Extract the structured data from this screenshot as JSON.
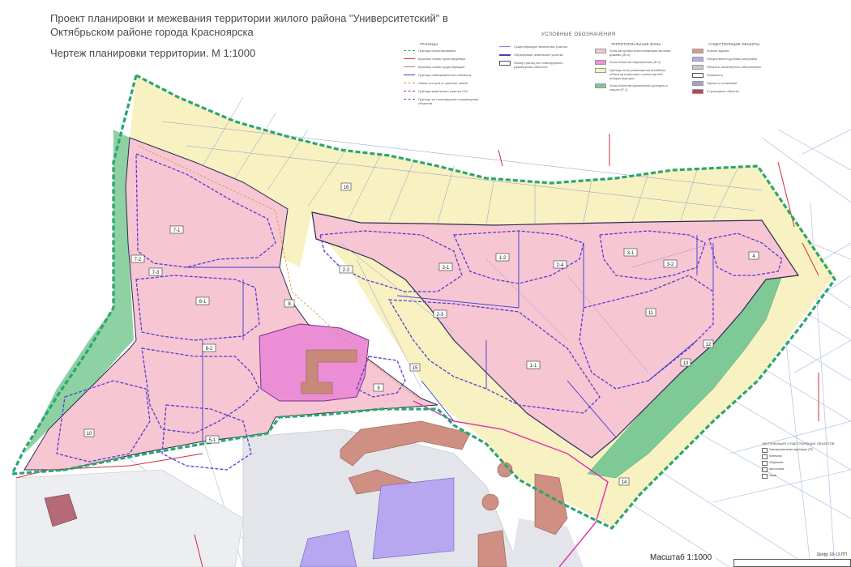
{
  "header": {
    "title": "Проект планировки и межевания территории жилого района \"Университетский\" в Октябрьском районе города Красноярска",
    "subtitle": "Чертеж планировки территории. М 1:1000"
  },
  "legend": {
    "heading": "УСЛОВНЫЕ ОБОЗНАЧЕНИЯ",
    "groups": [
      {
        "header": "ГРАНИЦЫ",
        "items": [
          {
            "label": "Граница проектирования",
            "color": "#2aa66e",
            "style": "dash-green"
          },
          {
            "label": "Красные линии проектируемые",
            "color": "#d23c3c",
            "style": "line-red"
          },
          {
            "label": "Красные линии существующие",
            "color": "#e07070",
            "style": "line-red-thin"
          },
          {
            "label": "Граница планировочного элемента",
            "color": "#3a3ad0",
            "style": "line-blue"
          },
          {
            "label": "Линии отступа от красных линий",
            "color": "#e09040",
            "style": "dash-orange"
          },
          {
            "label": "Граница земельного участка СЗУ",
            "color": "#8a3ad0",
            "style": "dash-purple"
          },
          {
            "label": "Граница зон планируемого размещения объектов",
            "color": "#5a5ae0",
            "style": "dash-blue"
          }
        ]
      },
      {
        "header": "",
        "items": [
          {
            "label": "Существующие земельные участки",
            "color": "#8080ff",
            "style": "line-thin"
          },
          {
            "label": "Образуемые земельные участки",
            "color": "#4040c0",
            "style": "line-thick"
          },
          {
            "label": "Номер границ зон планируемого размещения объектов",
            "color": "#ffffff",
            "style": "box"
          }
        ]
      },
      {
        "header": "ТЕРРИТОРИАЛЬНЫЕ ЗОНЫ",
        "items": [
          {
            "label": "Зона застройки многоэтажными жилыми домами (Ж-4)",
            "color": "#f5c4d2",
            "style": "fill"
          },
          {
            "label": "Зона объектов образования (Ж-2)",
            "color": "#ee90d8",
            "style": "fill"
          },
          {
            "label": "Граница зоны размещения линейных объектов инженерно-транспортной инфраструктуры",
            "color": "#f8f1c0",
            "style": "fill"
          },
          {
            "label": "Зона объектов физической культуры и спорта (Р-1)",
            "color": "#7ec995",
            "style": "fill"
          }
        ]
      },
      {
        "header": "СУЩЕСТВУЮЩИЕ ОБЪЕКТЫ",
        "items": [
          {
            "label": "Жилые здания",
            "color": "#d89a8a",
            "style": "fill"
          },
          {
            "label": "Общественно-деловая застройка",
            "color": "#b8a8f0",
            "style": "fill"
          },
          {
            "label": "Объекты инженерного обеспечения",
            "color": "#c8c8c8",
            "style": "fill"
          },
          {
            "label": "Этажность",
            "color": "#ffffff",
            "style": "box"
          },
          {
            "label": "Гараж со стоянками",
            "color": "#a0a0d0",
            "style": "fill"
          },
          {
            "label": "Строящиеся объекты",
            "color": "#c04060",
            "style": "fill"
          }
        ]
      }
    ]
  },
  "zones": [
    {
      "label": "16",
      "color": "#ffffff"
    },
    {
      "label": "7-1",
      "color": "#ffffff"
    },
    {
      "label": "7-2",
      "color": "#ffffff"
    },
    {
      "label": "7-3",
      "color": "#ffffff"
    },
    {
      "label": "6-1",
      "color": "#ffffff"
    },
    {
      "label": "8",
      "color": "#ffffff"
    },
    {
      "label": "6-2",
      "color": "#ffffff"
    },
    {
      "label": "5-1",
      "color": "#ffffff"
    },
    {
      "label": "10",
      "color": "#ffffff"
    },
    {
      "label": "9",
      "color": "#ffffff"
    },
    {
      "label": "15",
      "color": "#ffffff"
    },
    {
      "label": "2-1",
      "color": "#ffffff"
    },
    {
      "label": "2-2",
      "color": "#ffffff"
    },
    {
      "label": "2-3",
      "color": "#ffffff"
    },
    {
      "label": "2-4",
      "color": "#ffffff"
    },
    {
      "label": "3-1",
      "color": "#ffffff"
    },
    {
      "label": "3-2",
      "color": "#ffffff"
    },
    {
      "label": "4",
      "color": "#ffffff"
    },
    {
      "label": "1-2",
      "color": "#ffffff"
    },
    {
      "label": "1-1",
      "color": "#ffffff"
    },
    {
      "label": "11",
      "color": "#ffffff"
    },
    {
      "label": "12",
      "color": "#ffffff"
    },
    {
      "label": "13",
      "color": "#ffffff"
    },
    {
      "label": "14",
      "color": "#ffffff"
    }
  ],
  "coordination_table": {
    "heading": "ЭКСПЛИКАЦИЯ СУЩЕСТВУЮЩИХ ОБЪЕКТОВ",
    "rows": [
      "Трансформаторная подстанция (ТП)",
      "Котельная",
      "Общежитие",
      "Автостоянка",
      "Гараж"
    ]
  },
  "scale_label": "Масштаб 1:1000",
  "stamp_label": "Шифр 18-13-ПП"
}
